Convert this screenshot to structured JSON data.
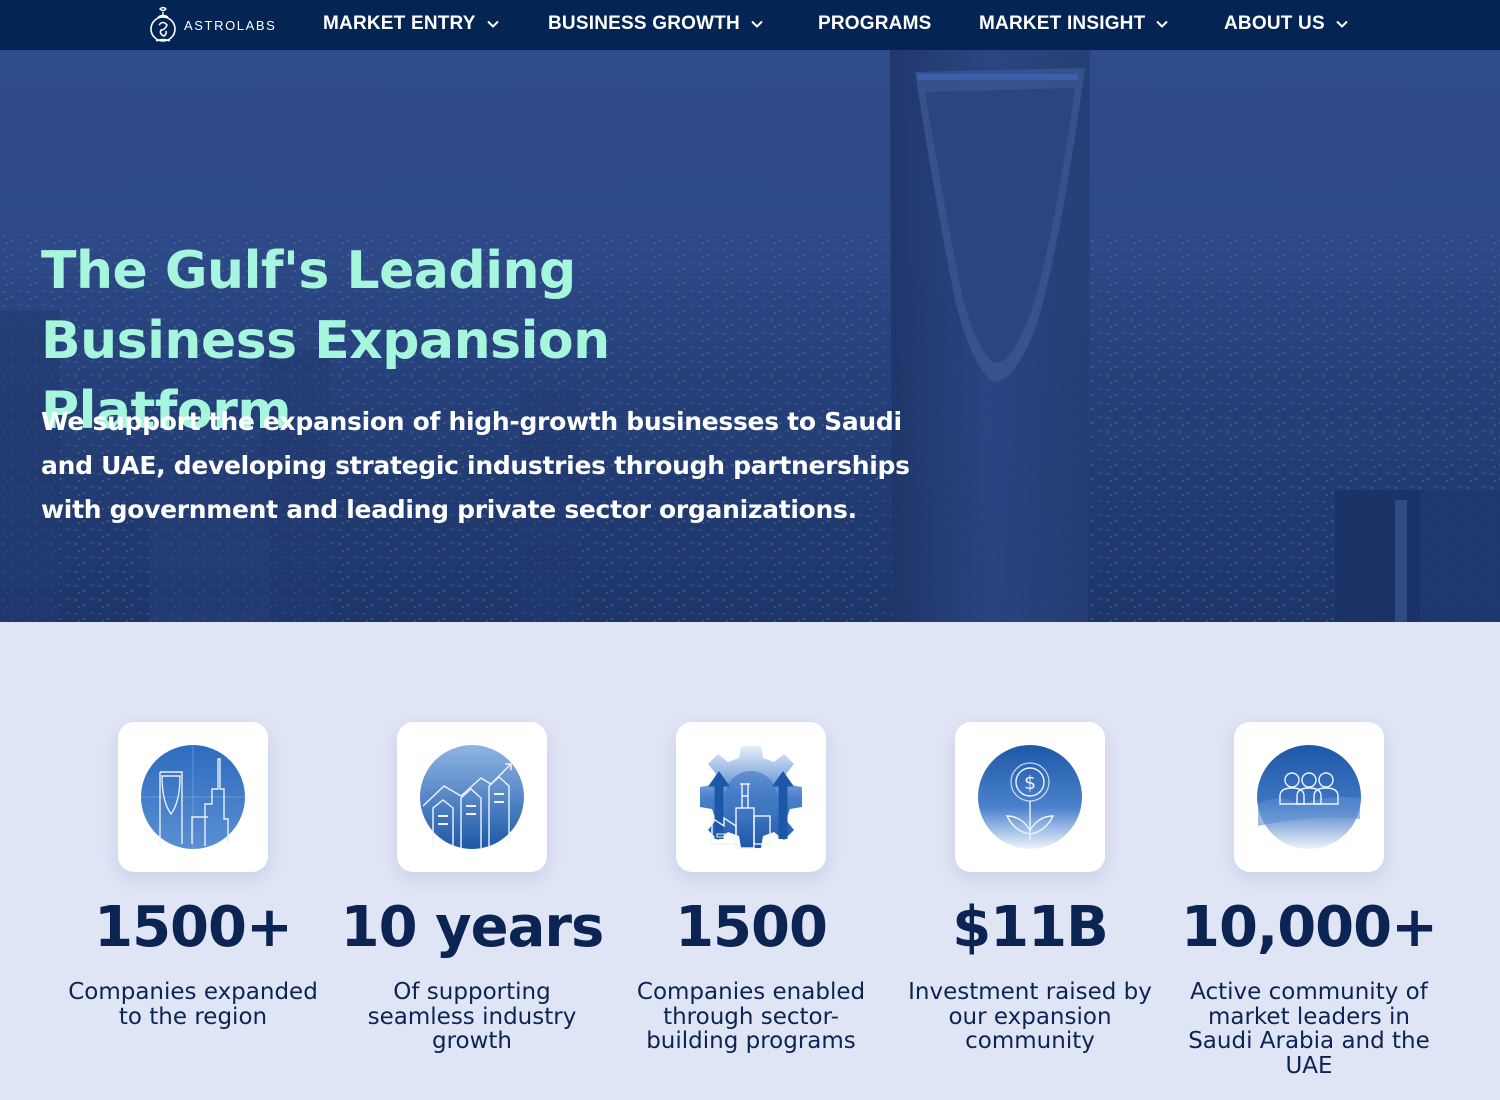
{
  "nav": {
    "brand": "ASTROLABS",
    "items": [
      {
        "label": "MARKET ENTRY",
        "has_dropdown": true
      },
      {
        "label": "BUSINESS GROWTH",
        "has_dropdown": true
      },
      {
        "label": "PROGRAMS",
        "has_dropdown": false
      },
      {
        "label": "MARKET INSIGHT",
        "has_dropdown": true
      },
      {
        "label": "ABOUT US",
        "has_dropdown": true
      }
    ]
  },
  "hero": {
    "title": "The Gulf's Leading Business Expansion Platform",
    "subtitle": "We support the expansion of high-growth businesses to Saudi and UAE, developing strategic industries through partnerships with government and leading private sector organizations.",
    "background": "riyadh-skyline-kingdom-centre"
  },
  "stats": [
    {
      "icon": "gulf-skyline-icon",
      "value": "1500+",
      "label": "Companies expanded to the region"
    },
    {
      "icon": "growth-chart-icon",
      "value": "10 years",
      "label": "Of supporting seamless industry growth"
    },
    {
      "icon": "industry-gear-icon",
      "value": "1500",
      "label": "Companies enabled through sector-building programs"
    },
    {
      "icon": "investment-coin-icon",
      "value": "$11B",
      "label": "Investment raised by our expansion community"
    },
    {
      "icon": "community-people-icon",
      "value": "10,000+",
      "label": "Active community of market leaders in Saudi Arabia and the UAE"
    }
  ],
  "colors": {
    "nav_bg": "#042554",
    "hero_title": "#a6f5dd",
    "stats_bg": "#dfe5f5",
    "stat_text": "#0c2453",
    "icon_blue": "#1c5aa8"
  }
}
